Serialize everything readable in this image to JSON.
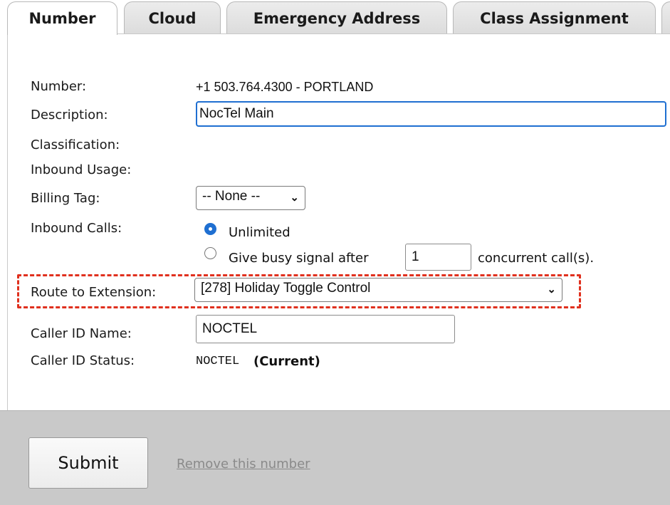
{
  "tabs": [
    {
      "label": "Number",
      "active": true
    },
    {
      "label": "Cloud"
    },
    {
      "label": "Emergency Address"
    },
    {
      "label": "Class Assignment"
    }
  ],
  "form": {
    "number_label": "Number:",
    "number_value": "+1 503.764.4300 - PORTLAND",
    "description_label": "Description:",
    "description_value": "NocTel Main",
    "classification_label": "Classification:",
    "inbound_usage_label": "Inbound Usage:",
    "billing_tag_label": "Billing Tag:",
    "billing_tag_value": "-- None --",
    "inbound_calls_label": "Inbound Calls:",
    "inbound_option_unlimited": "Unlimited",
    "inbound_option_busy": "Give busy signal after",
    "concurrent_value": "1",
    "concurrent_suffix": "concurrent call(s).",
    "route_label": "Route to Extension:",
    "route_value": "[278] Holiday Toggle Control",
    "caller_id_name_label": "Caller ID Name:",
    "caller_id_name_value": "NOCTEL",
    "caller_id_status_label": "Caller ID Status:",
    "caller_id_status_value": "NOCTEL",
    "caller_id_status_current": "(Current)"
  },
  "footer": {
    "submit_label": "Submit",
    "remove_label": "Remove this number"
  },
  "colors": {
    "accent": "#1f6fd1",
    "highlight": "#e0301e",
    "footer_bg": "#c9c9c9"
  },
  "icons": {
    "select_chevron": "chevron-down-icon"
  }
}
